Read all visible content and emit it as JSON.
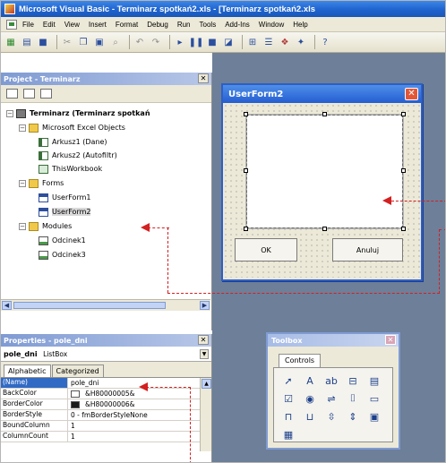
{
  "window": {
    "title": "Microsoft Visual Basic - Terminarz spotkań2.xls - [Terminarz spotkań2.xls"
  },
  "menu": {
    "items": [
      "File",
      "Edit",
      "View",
      "Insert",
      "Format",
      "Debug",
      "Run",
      "Tools",
      "Add-Ins",
      "Window",
      "Help"
    ]
  },
  "toolbar": {
    "icons": [
      "excel-icon",
      "insert-icon",
      "save-icon",
      "cut-icon",
      "copy-icon",
      "paste-icon",
      "find-icon",
      "undo-icon",
      "redo-icon",
      "run-icon",
      "break-icon",
      "reset-icon",
      "design-mode-icon",
      "project-explorer-icon",
      "properties-icon",
      "object-browser-icon",
      "toolbox-icon",
      "help-icon"
    ]
  },
  "project": {
    "title": "Project - Terminarz",
    "tree": [
      {
        "label": "Terminarz (Terminarz spotkań",
        "icon": "vba-project-icon",
        "bold": true
      },
      {
        "label": "Microsoft Excel Objects",
        "icon": "folder-icon"
      },
      {
        "label": "Arkusz1 (Dane)",
        "icon": "sheet-icon"
      },
      {
        "label": "Arkusz2 (Autofiltr)",
        "icon": "sheet-icon"
      },
      {
        "label": "ThisWorkbook",
        "icon": "workbook-icon"
      },
      {
        "label": "Forms",
        "icon": "folder-icon"
      },
      {
        "label": "UserForm1",
        "icon": "form-icon"
      },
      {
        "label": "UserForm2",
        "icon": "form-icon"
      },
      {
        "label": "Modules",
        "icon": "folder-icon"
      },
      {
        "label": "Odcinek1",
        "icon": "module-icon"
      },
      {
        "label": "Odcinek3",
        "icon": "module-icon"
      }
    ]
  },
  "properties": {
    "title": "Properties - pole_dni",
    "object_name": "pole_dni",
    "object_type": "ListBox",
    "tabs": [
      "Alphabetic",
      "Categorized"
    ],
    "rows": [
      {
        "name": "(Name)",
        "value": "pole_dni"
      },
      {
        "name": "BackColor",
        "value": "&H80000005&",
        "swatch": "#ffffff"
      },
      {
        "name": "BorderColor",
        "value": "&H80000006&",
        "swatch": "#1a1a1a"
      },
      {
        "name": "BorderStyle",
        "value": "0 - fmBorderStyleNone"
      },
      {
        "name": "BoundColumn",
        "value": "1"
      },
      {
        "name": "ColumnCount",
        "value": "1"
      }
    ]
  },
  "userform": {
    "title": "UserForm2",
    "ok_label": "OK",
    "cancel_label": "Anuluj"
  },
  "toolbox": {
    "title": "Toolbox",
    "tab": "Controls",
    "tools": [
      "pointer-icon",
      "label-icon",
      "textbox-icon",
      "combobox-icon",
      "listbox-icon",
      "checkbox-icon",
      "optionbutton-icon",
      "togglebutton-icon",
      "frame-icon",
      "commandbutton-icon",
      "tabstrip-icon",
      "multipage-icon",
      "scrollbar-icon",
      "spinbutton-icon",
      "image-icon",
      "refedit-icon"
    ]
  },
  "colors": {
    "titlebar": "#1f63cf",
    "annotation": "#d42020",
    "selection": "#316ac5"
  }
}
